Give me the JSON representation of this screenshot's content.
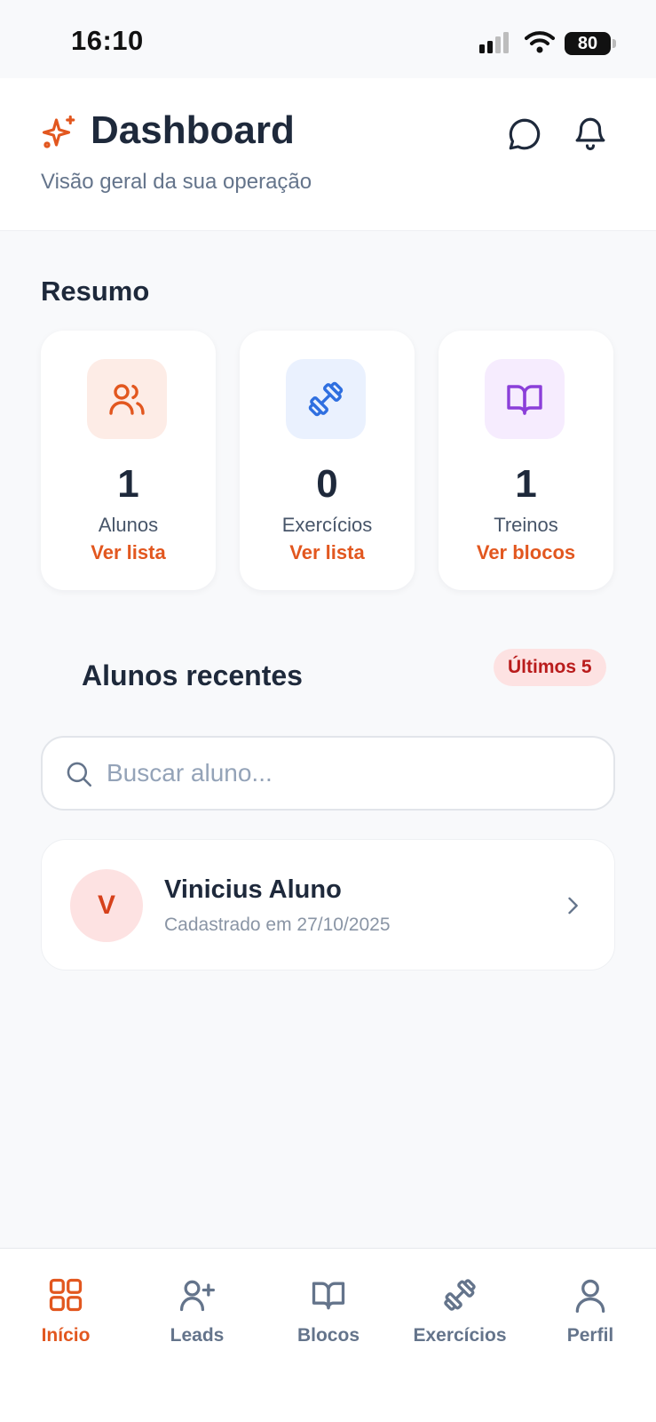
{
  "status_bar": {
    "time": "16:10",
    "battery": "80"
  },
  "header": {
    "title": "Dashboard",
    "subtitle": "Visão geral da sua operação"
  },
  "summary": {
    "title": "Resumo",
    "cards": [
      {
        "value": "1",
        "label": "Alunos",
        "link": "Ver lista",
        "icon": "users-icon",
        "color": "#e2571f",
        "bg": "#fdece6"
      },
      {
        "value": "0",
        "label": "Exercícios",
        "link": "Ver lista",
        "icon": "dumbbell-icon",
        "color": "#2f6fe0",
        "bg": "#eaf1fe"
      },
      {
        "value": "1",
        "label": "Treinos",
        "link": "Ver blocos",
        "icon": "book-icon",
        "color": "#8b3fd9",
        "bg": "#f6ecfe"
      }
    ]
  },
  "recent": {
    "title": "Alunos recentes",
    "badge": "Últimos 5",
    "search_placeholder": "Buscar aluno...",
    "students": [
      {
        "initial": "V",
        "name": "Vinicius Aluno",
        "registered": "Cadastrado em 27/10/2025"
      }
    ]
  },
  "nav": {
    "items": [
      {
        "label": "Início",
        "icon": "grid-icon",
        "active": true
      },
      {
        "label": "Leads",
        "icon": "user-plus-icon",
        "active": false
      },
      {
        "label": "Blocos",
        "icon": "book-icon",
        "active": false
      },
      {
        "label": "Exercícios",
        "icon": "dumbbell-icon",
        "active": false
      },
      {
        "label": "Perfil",
        "icon": "user-icon",
        "active": false
      }
    ]
  },
  "colors": {
    "accent": "#e2571f",
    "text": "#1e293b",
    "muted": "#64748b",
    "background": "#f8f9fb"
  }
}
